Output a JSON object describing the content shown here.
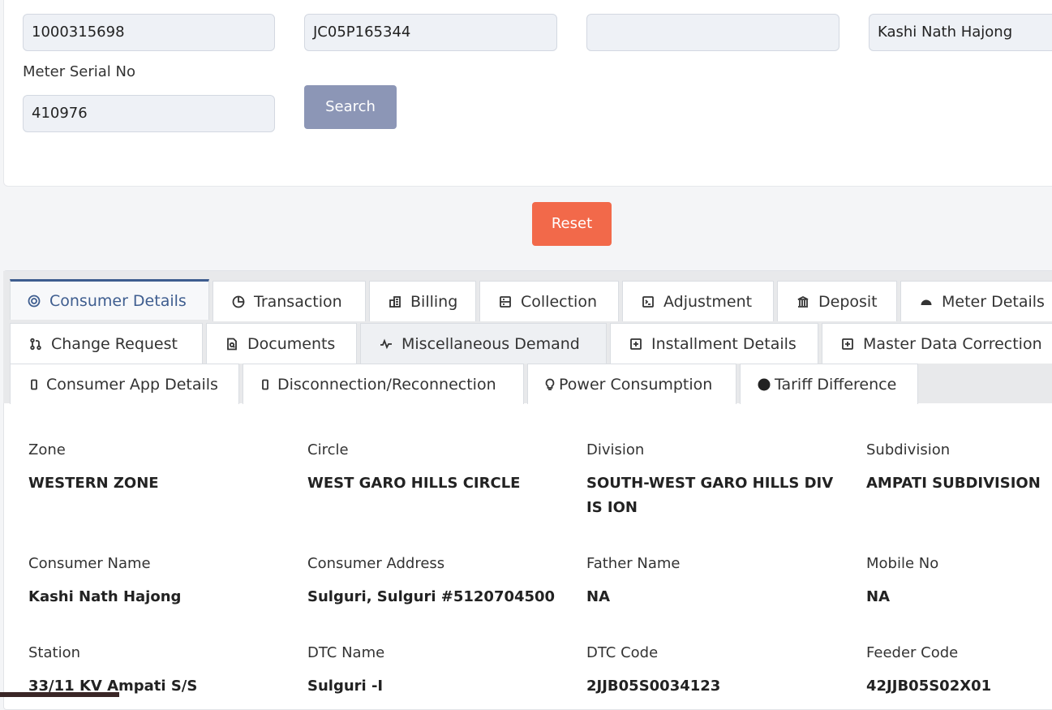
{
  "search": {
    "consumer_no": "1000315698",
    "legacy_no": "JC05P165344",
    "field3": "",
    "consumer_name": "Kashi Nath Hajong",
    "meter_serial_label": "Meter Serial No",
    "meter_serial": "410976",
    "search_label": "Search",
    "reset_label": "Reset"
  },
  "tabs": [
    {
      "label": "Consumer Details",
      "icon": "target-icon"
    },
    {
      "label": "Transaction",
      "icon": "pie-chart-icon"
    },
    {
      "label": "Billing",
      "icon": "billing-icon"
    },
    {
      "label": "Collection",
      "icon": "collection-icon"
    },
    {
      "label": "Adjustment",
      "icon": "terminal-icon"
    },
    {
      "label": "Deposit",
      "icon": "bank-icon"
    },
    {
      "label": "Meter Details",
      "icon": "speedometer-icon"
    },
    {
      "label": "Change Request",
      "icon": "git-pull-icon"
    },
    {
      "label": "Documents",
      "icon": "document-search-icon"
    },
    {
      "label": "Miscellaneous Demand",
      "icon": "pulse-icon"
    },
    {
      "label": "Installment Details",
      "icon": "plus-box-icon"
    },
    {
      "label": "Master Data Correction",
      "icon": "plus-box-icon"
    },
    {
      "label": "Consumer App Details",
      "icon": "mobile-icon"
    },
    {
      "label": "Disconnection/Reconnection",
      "icon": "mobile-icon"
    },
    {
      "label": "Power Consumption",
      "icon": "bulb-icon"
    },
    {
      "label": "Tariff Difference",
      "icon": "circle-icon"
    }
  ],
  "details": [
    {
      "label": "Zone",
      "value": "WESTERN ZONE"
    },
    {
      "label": "Circle",
      "value": "WEST GARO HILLS CIRCLE"
    },
    {
      "label": "Division",
      "value": "SOUTH-WEST GARO HILLS DIVIS ION"
    },
    {
      "label": "Subdivision",
      "value": "AMPATI SUBDIVISION"
    },
    {
      "label": "Consumer Name",
      "value": "Kashi Nath Hajong"
    },
    {
      "label": "Consumer Address",
      "value": "Sulguri, Sulguri #5120704500"
    },
    {
      "label": "Father Name",
      "value": "NA"
    },
    {
      "label": "Mobile No",
      "value": "NA"
    },
    {
      "label": "Station",
      "value": "33/11 KV Ampati S/S"
    },
    {
      "label": "DTC Name",
      "value": "Sulguri -I"
    },
    {
      "label": "DTC Code",
      "value": "2JJB05S0034123"
    },
    {
      "label": "Feeder Code",
      "value": "42JJB05S02X01"
    }
  ],
  "colors": {
    "primary": "#3e5d8f",
    "search_button": "#8c96b6",
    "reset_button": "#f2694a"
  }
}
